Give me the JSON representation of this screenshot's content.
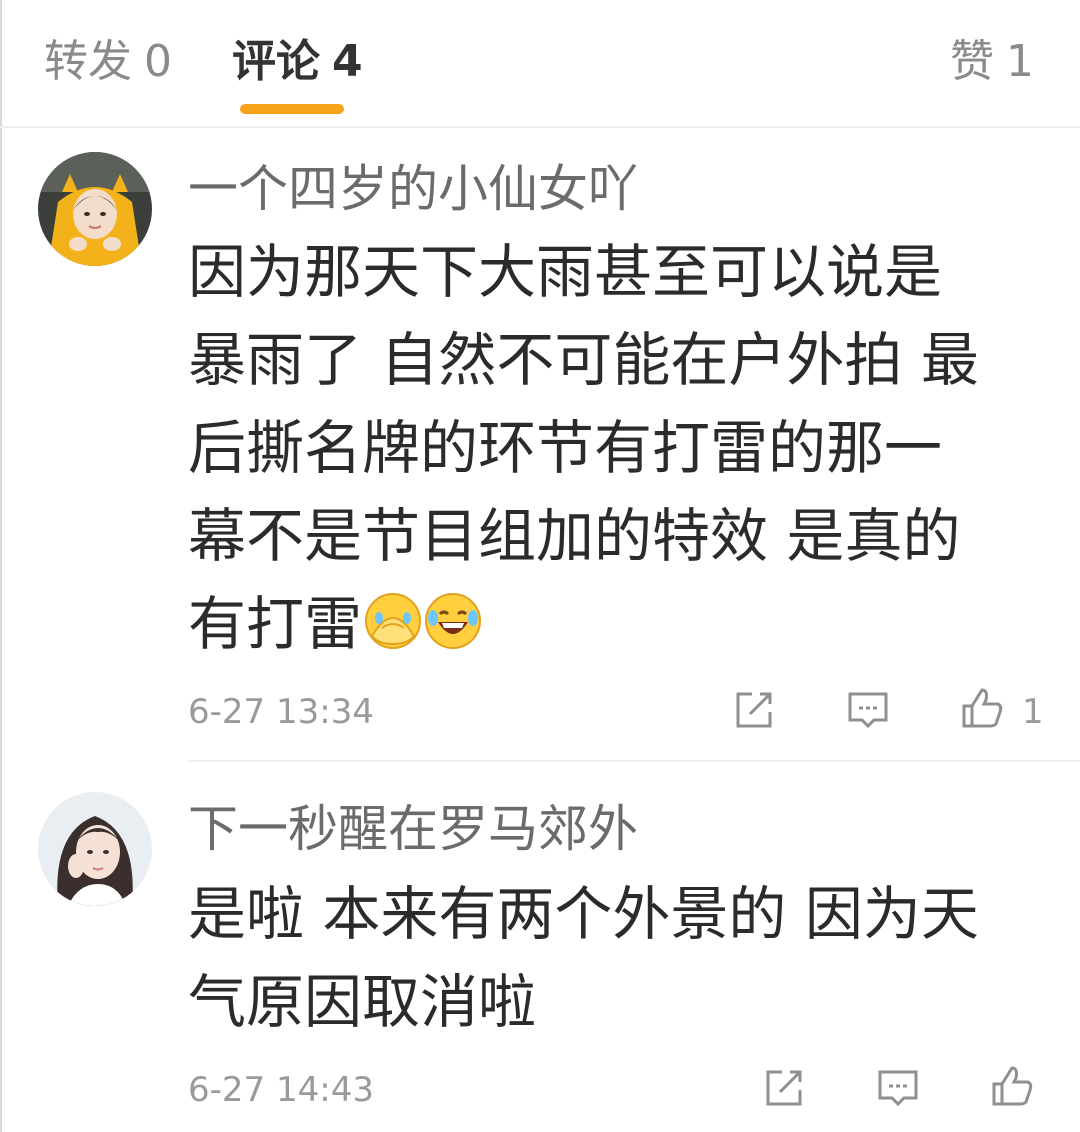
{
  "tabs": {
    "repost_label": "转发",
    "repost_count": "0",
    "comments_label": "评论",
    "comments_count": "4",
    "likes_label": "赞",
    "likes_count": "1"
  },
  "accent_color": "#f7a21b",
  "comments": [
    {
      "username": "一个四岁的小仙女吖",
      "lines": [
        "因为那天下大雨甚至可以说是",
        "暴雨了 自然不可能在户外拍 最",
        "后撕名牌的环节有打雷的那一",
        "幕不是节目组加的特效 是真的",
        "有打雷"
      ],
      "emojis": [
        "facepalm-emoji",
        "laughing-tears-emoji"
      ],
      "time": "6-27 13:34",
      "like_count": "1",
      "actions": [
        "repost-icon",
        "reply-icon",
        "like-icon"
      ]
    },
    {
      "username": "下一秒醒在罗马郊外",
      "lines": [
        "是啦 本来有两个外景的 因为天",
        "气原因取消啦"
      ],
      "time": "6-27 14:43",
      "like_count": "",
      "actions": [
        "repost-icon",
        "reply-icon",
        "like-icon"
      ]
    }
  ]
}
